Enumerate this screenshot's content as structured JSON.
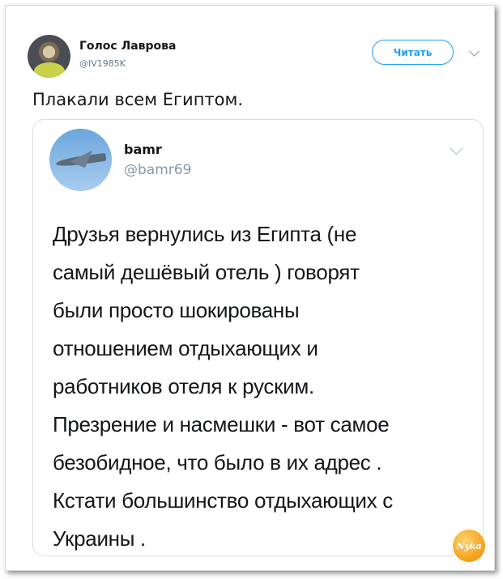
{
  "tweet": {
    "author": {
      "name": "Голос Лаврова",
      "handle": "@IV1985K",
      "avatar_icon": "user-avatar-icon"
    },
    "follow_label": "Читать",
    "text": "Плакали всем Египтом."
  },
  "quoted": {
    "author": {
      "name": "bamr",
      "handle": "@bamr69",
      "avatar_icon": "jet-avatar-icon"
    },
    "lines": [
      "Друзья вернулись из Египта (не",
      "самый дешёвый отель ) говорят",
      "были просто шокированы",
      "отношением отдыхающих и",
      "работников отеля к руским.",
      "Презрение и насмешки - вот самое",
      "безобидное, что было в их адрес .",
      "Кстати большинство отдыхающих с",
      "Украины ."
    ]
  },
  "watermark": {
    "text": "Nyka"
  },
  "colors": {
    "accent": "#1da1f2",
    "text": "#14171a",
    "muted": "#657786",
    "border": "#d6dee4"
  }
}
